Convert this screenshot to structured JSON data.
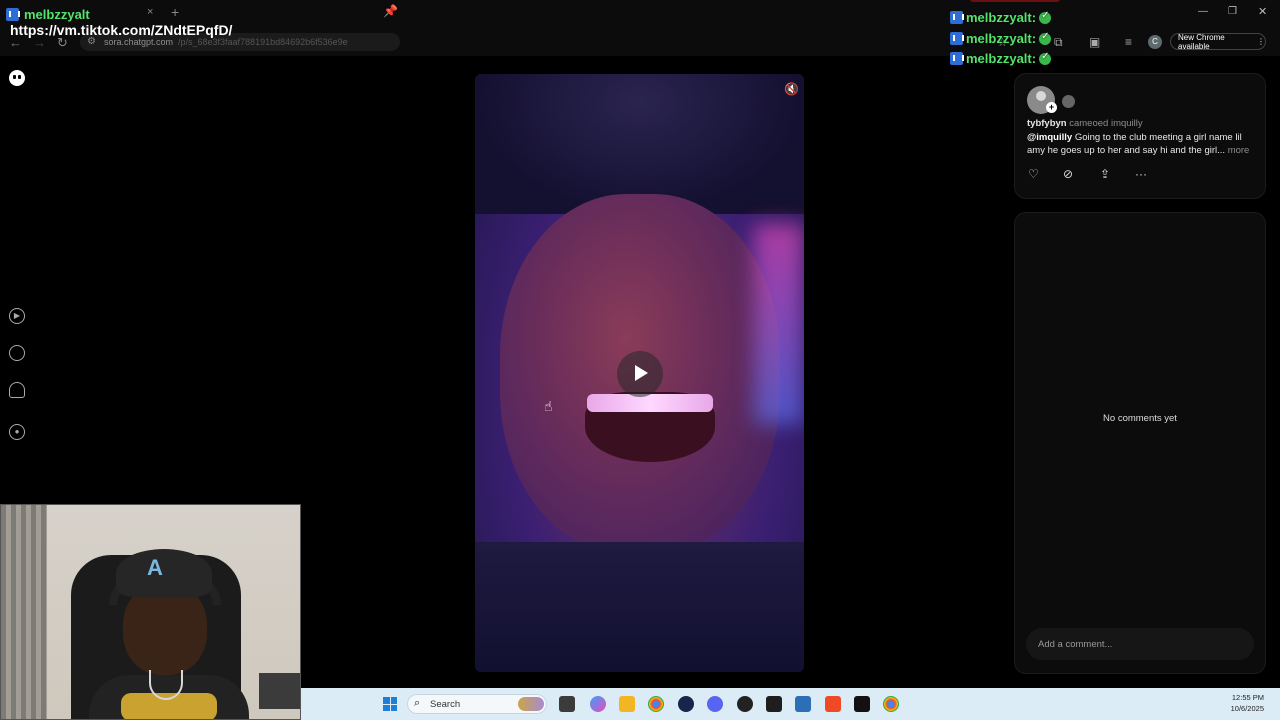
{
  "browser": {
    "tab_title": "melbzzyalt",
    "tab_close": "×",
    "new_tab": "+",
    "overlay_url": "https://vm.tiktok.com/ZNdtEPqfD/",
    "url_host": "sora.chatgpt.com",
    "url_path": "/p/s_68e3f3faaf788191bd84692b6f536e9e",
    "profile_initial": "C",
    "new_chrome_label": "New Chrome available",
    "new_chrome_menu": "⋮"
  },
  "chat": {
    "messages": [
      {
        "user": "melbzzyalt:"
      },
      {
        "user": "melbzzyalt:"
      },
      {
        "user": "melbzzyalt:"
      }
    ]
  },
  "post": {
    "author": "tybfybyn",
    "action": "cameoed",
    "cameo_user": "imquilly",
    "mention": "@imquilly",
    "caption": "Going to the club meeting a girl name lil amy he goes up to her and say hi and the girl...",
    "more_label": "more"
  },
  "comments": {
    "empty_text": "No comments yet",
    "input_placeholder": "Add a comment..."
  },
  "taskbar": {
    "search_label": "Search",
    "time": "12:55 PM",
    "date": "10/6/2025"
  },
  "colors": {
    "chat_username": "#54e36b",
    "taskbar_bg": "#dcecf6",
    "panel_bg": "#0c0c0c"
  },
  "icons": {
    "mute": "mute-icon",
    "play": "play-icon",
    "like": "heart-icon",
    "remix": "remix-icon",
    "share": "share-icon",
    "more": "more-icon"
  }
}
